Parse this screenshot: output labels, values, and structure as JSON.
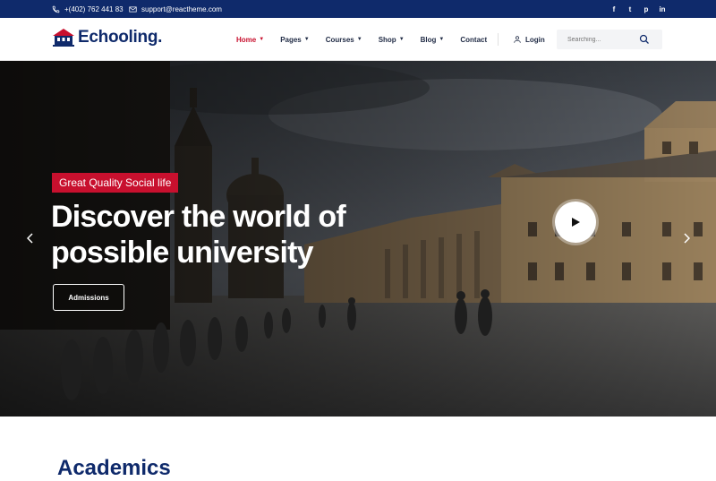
{
  "topbar": {
    "phone": "+(402) 762 441 83",
    "email": "support@reactheme.com",
    "social": [
      {
        "icon": "facebook-icon",
        "glyph": "f"
      },
      {
        "icon": "twitter-icon",
        "glyph": "t"
      },
      {
        "icon": "pinterest-icon",
        "glyph": "p"
      },
      {
        "icon": "linkedin-icon",
        "glyph": "in"
      }
    ]
  },
  "header": {
    "logo": "Echooling.",
    "nav": [
      {
        "label": "Home",
        "active": true,
        "dropdown": true
      },
      {
        "label": "Pages",
        "active": false,
        "dropdown": true
      },
      {
        "label": "Courses",
        "active": false,
        "dropdown": true
      },
      {
        "label": "Shop",
        "active": false,
        "dropdown": true
      },
      {
        "label": "Blog",
        "active": false,
        "dropdown": true
      },
      {
        "label": "Contact",
        "active": false,
        "dropdown": false
      }
    ],
    "login": "Login",
    "search_placeholder": "Searching..."
  },
  "hero": {
    "badge": "Great Quality Social life",
    "headline_line1": "Discover the world of",
    "headline_line2": "possible university",
    "cta": "Admissions"
  },
  "section": {
    "title": "Academics"
  },
  "colors": {
    "primary": "#0f2a6b",
    "accent": "#c8102e"
  }
}
